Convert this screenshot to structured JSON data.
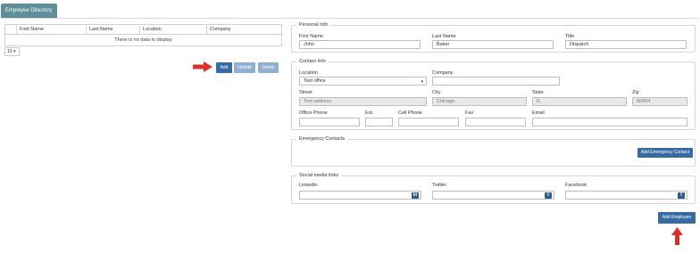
{
  "tab": {
    "label": "Employee Directory"
  },
  "grid": {
    "columns": [
      "",
      "First Name",
      "Last Name",
      "Location",
      "Company"
    ],
    "empty_message": "There is no data to display",
    "page_size": "10 ▾"
  },
  "actions": {
    "add": "Add",
    "update": "Update",
    "delete": "Delete"
  },
  "personal": {
    "legend": "Personal Info",
    "first_name_label": "First Name",
    "first_name": "John",
    "last_name_label": "Last Name",
    "last_name": "Baker",
    "title_label": "Title",
    "title": "Dispatch"
  },
  "contact": {
    "legend": "Contact Info",
    "location_label": "Location",
    "location": "Test office",
    "company_label": "Company",
    "company": "",
    "street_label": "Street",
    "street": "Test address",
    "city_label": "City",
    "city": "Chicago",
    "state_label": "State",
    "state": "IL",
    "zip_label": "Zip",
    "zip": "60604",
    "office_phone_label": "Office Phone",
    "ext_label": "Ext.",
    "cell_phone_label": "Cell Phone",
    "fax_label": "Fax",
    "email_label": "Email"
  },
  "emergency": {
    "legend": "Emergency Contacts",
    "add_button": "Add Emergency Contact"
  },
  "social": {
    "legend": "Social media links",
    "linkedin_label": "Linkedin",
    "twitter_label": "Twitter",
    "facebook_label": "Facebook",
    "icons": {
      "linkedin": "in",
      "twitter": "t",
      "facebook": "f"
    }
  },
  "footer": {
    "add_employee": "Add Employee"
  },
  "colors": {
    "tab": "#5e8e98",
    "primary": "#376aa3",
    "arrow": "#d9302b"
  }
}
